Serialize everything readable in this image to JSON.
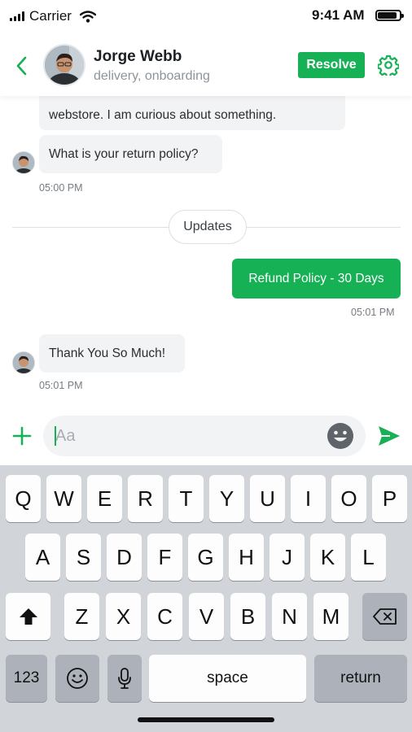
{
  "status_bar": {
    "carrier": "Carrier",
    "time": "9:41 AM",
    "battery_level": 0.9
  },
  "header": {
    "contact_name": "Jorge Webb",
    "contact_tags": "delivery, onboarding",
    "resolve_label": "Resolve",
    "back_icon": "chevron-left-icon",
    "settings_icon": "gear-icon",
    "accent_color": "#16b055"
  },
  "messages": [
    {
      "direction": "incoming",
      "text": "webstore. I am curious about something."
    },
    {
      "direction": "incoming",
      "text": "What is your return policy?",
      "time": "05:00 PM"
    },
    {
      "type": "divider",
      "text": "Updates"
    },
    {
      "direction": "outgoing",
      "text": "Refund Policy - 30 Days",
      "time": "05:01 PM"
    },
    {
      "direction": "incoming",
      "text": "Thank You So Much!",
      "time": "05:01 PM"
    }
  ],
  "composer": {
    "placeholder": "Aa",
    "value": "",
    "add_icon": "plus-icon",
    "emoji_icon": "smiley-icon",
    "send_icon": "send-icon"
  },
  "keyboard": {
    "row1": [
      "Q",
      "W",
      "E",
      "R",
      "T",
      "Y",
      "U",
      "I",
      "O",
      "P"
    ],
    "row2": [
      "A",
      "S",
      "D",
      "F",
      "G",
      "H",
      "J",
      "K",
      "L"
    ],
    "row3": [
      "Z",
      "X",
      "C",
      "V",
      "B",
      "N",
      "M"
    ],
    "numbers_label": "123",
    "space_label": "space",
    "return_label": "return",
    "shift_icon": "shift-icon",
    "backspace_icon": "backspace-icon",
    "emoji_icon": "emoji-icon",
    "mic_icon": "microphone-icon"
  }
}
